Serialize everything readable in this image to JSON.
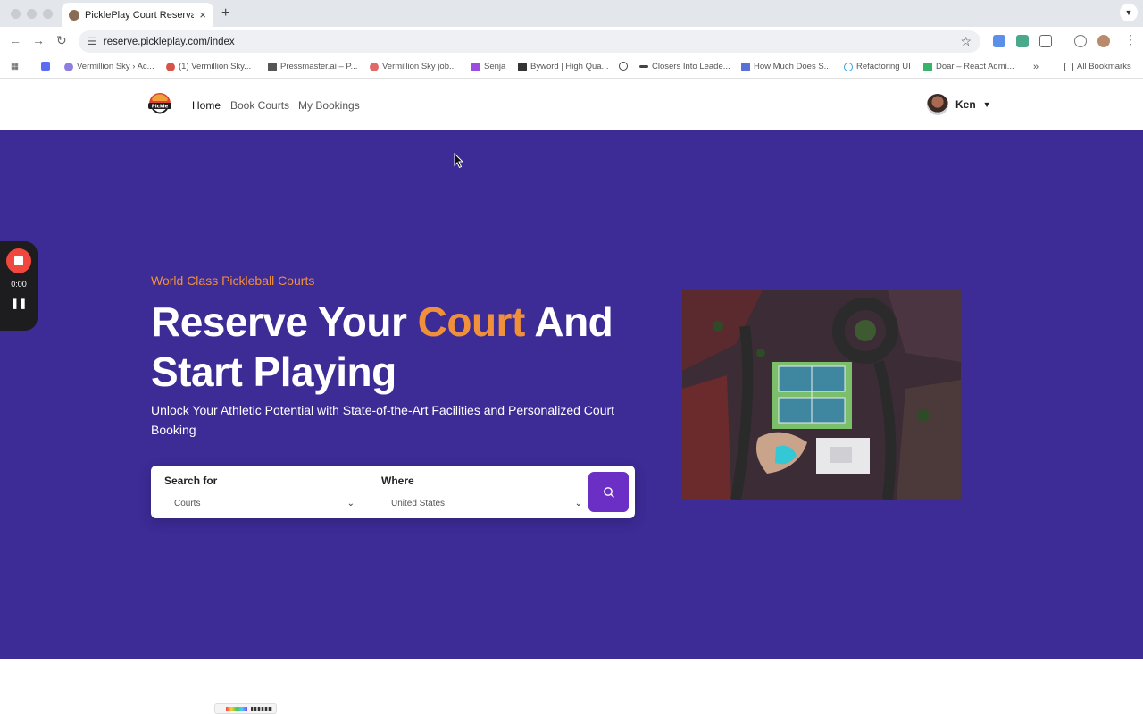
{
  "browser": {
    "tab_title": "PicklePlay Court Reservation",
    "tab_close": "×",
    "new_tab": "+",
    "url": "reserve.pickleplay.com/index",
    "bookmarks": [
      {
        "label": "Vermillion Sky › Ac...",
        "color": "#8d7fe0"
      },
      {
        "label": "(1) Vermillion Sky...",
        "color": "#d6554a"
      },
      {
        "label": "Pressmaster.ai – P...",
        "color": "#555555"
      },
      {
        "label": "Vermillion Sky job...",
        "color": "#e06a6a"
      },
      {
        "label": "Senja",
        "color": "#9b4de0"
      },
      {
        "label": "Byword | High Qua...",
        "color": "#333333"
      },
      {
        "label": "Closers Into Leade...",
        "color": "#444444"
      },
      {
        "label": "How Much Does S...",
        "color": "#5a6fd8"
      },
      {
        "label": "Refactoring UI",
        "color": "#3aa0e0"
      },
      {
        "label": "Doar – React Admi...",
        "color": "#3bb26b"
      }
    ],
    "more_bookmarks": "»",
    "all_bookmarks": "All Bookmarks"
  },
  "site": {
    "nav": {
      "home": "Home",
      "book_courts": "Book Courts",
      "my_bookings": "My Bookings"
    },
    "user": {
      "name": "Ken"
    }
  },
  "hero": {
    "eyebrow": "World Class Pickleball Courts",
    "headline_part1": "Reserve Your ",
    "headline_accent": "Court",
    "headline_part2": " And Start Playing",
    "subline": "Unlock Your Athletic Potential with State-of-the-Art Facilities and Personalized Court Booking",
    "search": {
      "search_for_label": "Search for",
      "search_for_value": "Courts",
      "where_label": "Where",
      "where_value": "United States"
    }
  },
  "recorder": {
    "time": "0:00"
  },
  "colors": {
    "hero_bg": "#3d2b96",
    "accent_orange": "#f0903a",
    "search_button": "#6b2fc6",
    "record_red": "#f0483e"
  }
}
